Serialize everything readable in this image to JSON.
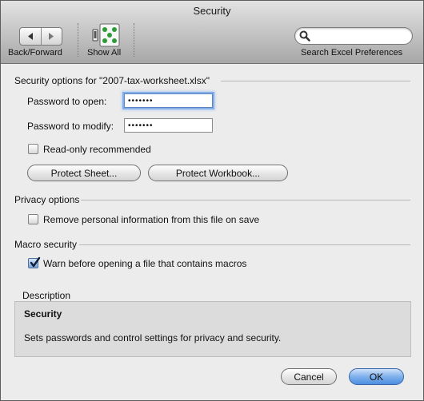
{
  "window": {
    "title": "Security"
  },
  "toolbar": {
    "back_forward_label": "Back/Forward",
    "show_all_label": "Show All",
    "search_placeholder": "",
    "search_label": "Search Excel Preferences"
  },
  "security_section": {
    "title": "Security options for \"2007-tax-worksheet.xlsx\"",
    "password_open_label": "Password to open:",
    "password_open_value": "•••••••",
    "password_modify_label": "Password to modify:",
    "password_modify_value": "•••••••",
    "readonly_label": "Read-only recommended",
    "readonly_checked": false,
    "protect_sheet_label": "Protect Sheet...",
    "protect_workbook_label": "Protect Workbook..."
  },
  "privacy_section": {
    "title": "Privacy options",
    "remove_info_label": "Remove personal information from this file on save",
    "remove_info_checked": false
  },
  "macro_section": {
    "title": "Macro security",
    "warn_label": "Warn before opening a file that contains macros",
    "warn_checked": true
  },
  "description": {
    "title": "Description",
    "heading": "Security",
    "text": "Sets passwords and control settings for privacy and security."
  },
  "buttons": {
    "cancel": "Cancel",
    "ok": "OK"
  },
  "colors": {
    "focus_ring": "#86aee7",
    "default_button": "#4d8fe0",
    "checkbox_checked": "#7aa5d8"
  },
  "icons": [
    "back-arrow-icon",
    "forward-arrow-icon",
    "show-all-icon",
    "search-icon",
    "checkmark-icon"
  ]
}
